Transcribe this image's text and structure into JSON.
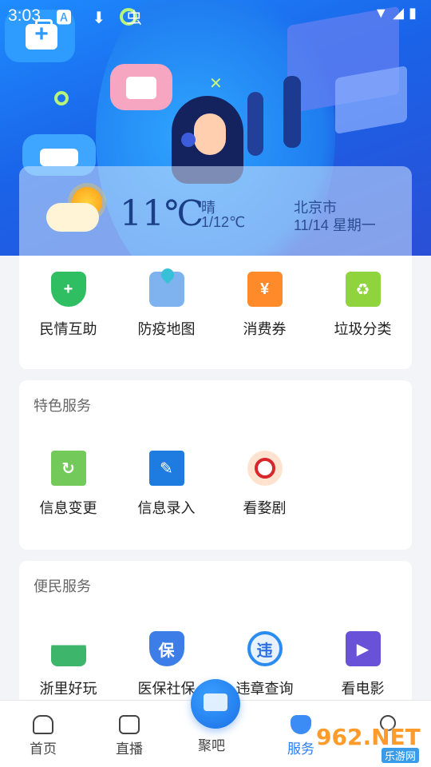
{
  "status_bar": {
    "time": "3:03",
    "left_icons": "🅰 ⬇ 虫",
    "right_icons": "▼◢▮"
  },
  "weather": {
    "temperature": "11℃",
    "condition": "晴",
    "range": "1/12℃",
    "city": "北京市",
    "date": "11/14  星期一"
  },
  "quick_services": [
    {
      "label": "民情互助",
      "icon": "shield-plus-icon"
    },
    {
      "label": "防疫地图",
      "icon": "map-pin-icon"
    },
    {
      "label": "消费券",
      "icon": "coupon-icon"
    },
    {
      "label": "垃圾分类",
      "icon": "recycle-icon"
    }
  ],
  "featured": {
    "title": "特色服务",
    "items": [
      {
        "label": "信息变更",
        "icon": "info-change-icon"
      },
      {
        "label": "信息录入",
        "icon": "info-entry-icon"
      },
      {
        "label": "看婺剧",
        "icon": "opera-icon"
      }
    ]
  },
  "convenience": {
    "title": "便民服务",
    "items": [
      {
        "label": "浙里好玩",
        "icon": "mountain-icon",
        "glyph": ""
      },
      {
        "label": "医保社保",
        "icon": "insurance-icon",
        "glyph": "保"
      },
      {
        "label": "违章查询",
        "icon": "violation-search-icon",
        "glyph": "违"
      },
      {
        "label": "看电影",
        "icon": "film-icon",
        "glyph": "▶"
      }
    ]
  },
  "nav": {
    "home": "首页",
    "live": "直播",
    "center": "聚吧",
    "service": "服务",
    "active": "服务"
  },
  "watermark": {
    "brand": "962.NET",
    "sub": "乐游网"
  }
}
